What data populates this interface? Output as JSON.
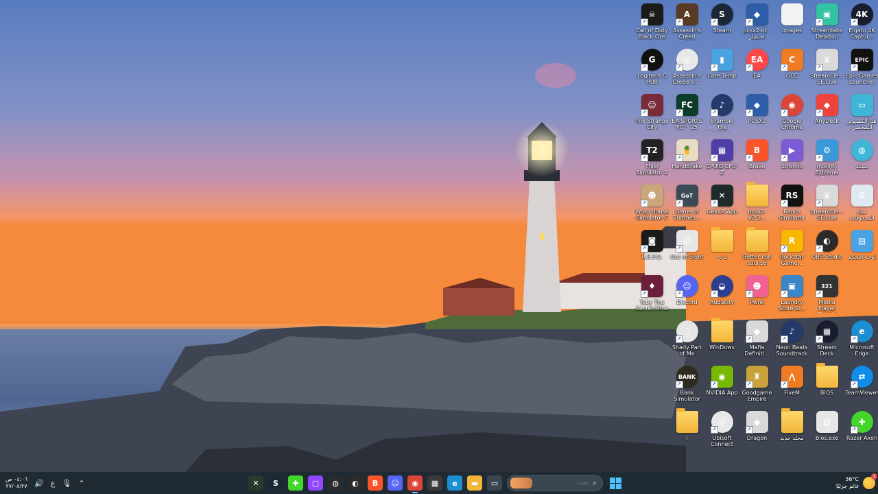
{
  "desktop": {
    "icons": [
      {
        "label": "Call of Duty Black Ops",
        "name": "call-of-duty-icon",
        "bg": "#1b1b1b",
        "glyph": "☠",
        "shortcut": true
      },
      {
        "label": "Assassin's Creed Mirage",
        "name": "assassins-creed-mirage-icon",
        "bg": "#5b3a24",
        "glyph": "A",
        "shortcut": true
      },
      {
        "label": "Steam",
        "name": "steam-icon",
        "bg": "#1b2838",
        "glyph": "S",
        "shortcut": true,
        "round": true
      },
      {
        "label": "pcsx2-qt - اختصار",
        "name": "pcsx2-qt-icon",
        "bg": "#2f5ea8",
        "glyph": "◆",
        "shortcut": true
      },
      {
        "label": "images",
        "name": "images-icon",
        "bg": "#f2f2f2",
        "glyph": "",
        "shortcut": false
      },
      {
        "label": "Streamlabs Desktop",
        "name": "streamlabs-icon",
        "bg": "#31c3a2",
        "glyph": "▣",
        "shortcut": true
      },
      {
        "label": "Elgato 4K Captur...",
        "name": "elgato-4k-icon",
        "bg": "#1a1d2e",
        "glyph": "4K",
        "shortcut": true,
        "round": true
      },
      {
        "label": "Logitech G HUB",
        "name": "logitech-g-hub-icon",
        "bg": "#111111",
        "glyph": "G",
        "shortcut": true,
        "round": true
      },
      {
        "label": "Assassin's Creed ®...",
        "name": "assassins-creed-2-icon",
        "bg": "#e8e8e8",
        "glyph": "◎",
        "shortcut": true,
        "round": true
      },
      {
        "label": "Core Temp",
        "name": "core-temp-icon",
        "bg": "#4aa3df",
        "glyph": "▮",
        "shortcut": true
      },
      {
        "label": "EA",
        "name": "ea-icon",
        "bg": "#ff4747",
        "glyph": "EA",
        "shortcut": true,
        "round": true
      },
      {
        "label": "GCC",
        "name": "gcc-icon",
        "bg": "#f07b23",
        "glyph": "C",
        "shortcut": true
      },
      {
        "label": "StreamEle... SE.Live",
        "name": "streamelements-se-live-icon",
        "bg": "#d9d9d9",
        "glyph": "♛",
        "shortcut": true
      },
      {
        "label": "Epic Games Launcher",
        "name": "epic-games-icon",
        "bg": "#111111",
        "glyph": "EPIC",
        "shortcut": true
      },
      {
        "label": "The Strange City",
        "name": "the-strange-city-icon",
        "bg": "#7a2b3a",
        "glyph": "☺",
        "shortcut": true
      },
      {
        "label": "EA SPORTS FC™ 25",
        "name": "ea-sports-fc-icon",
        "bg": "#0c3c2a",
        "glyph": "FC",
        "shortcut": true
      },
      {
        "label": "Bramble The Mountain ...",
        "name": "bramble-icon",
        "bg": "#233a6b",
        "glyph": "♪",
        "shortcut": true,
        "round": true
      },
      {
        "label": "PCSX2",
        "name": "pcsx2-icon",
        "bg": "#2f5ea8",
        "glyph": "◆",
        "shortcut": true
      },
      {
        "label": "Google Chrome",
        "name": "google-chrome-icon",
        "bg": "#db4437",
        "glyph": "◉",
        "shortcut": true,
        "round": true
      },
      {
        "label": "AnyDesk",
        "name": "anydesk-icon",
        "bg": "#ef443b",
        "glyph": "◆",
        "shortcut": true
      },
      {
        "label": "هذا الكمبيوتر الشخصي",
        "name": "this-pc-icon",
        "bg": "#3fb6d8",
        "glyph": "▭",
        "shortcut": false
      },
      {
        "label": "Thief Simulator 2",
        "name": "thief-simulator-2-icon",
        "bg": "#222222",
        "glyph": "T2",
        "shortcut": true
      },
      {
        "label": "HandBrake",
        "name": "handbrake-icon",
        "bg": "#e8dcc2",
        "glyph": "🍍",
        "shortcut": true
      },
      {
        "label": "CPUID CPU-Z",
        "name": "cpu-z-icon",
        "bg": "#4f3ea8",
        "glyph": "▦",
        "shortcut": true
      },
      {
        "label": "Brave",
        "name": "brave-icon",
        "bg": "#fb542b",
        "glyph": "B",
        "shortcut": true
      },
      {
        "label": "Stremio",
        "name": "stremio-icon",
        "bg": "#7b5bd6",
        "glyph": "▶",
        "shortcut": true
      },
      {
        "label": "Intel(R) Extreme Tu...",
        "name": "intel-xtu-icon",
        "bg": "#3a9ad9",
        "glyph": "⚙",
        "shortcut": true
      },
      {
        "label": "شبكة",
        "name": "network-icon",
        "bg": "#3fb6d8",
        "glyph": "◍",
        "shortcut": false,
        "round": true
      },
      {
        "label": "Wrap House Simulator C",
        "name": "wrap-house-simulator-icon",
        "bg": "#c9a77a",
        "glyph": "☻",
        "shortcut": true
      },
      {
        "label": "Game of Thrones...",
        "name": "game-of-thrones-icon",
        "bg": "#3c4a55",
        "glyph": "GoT",
        "shortcut": true
      },
      {
        "label": "GeXLR App",
        "name": "goxlr-app-icon",
        "bg": "#1e2b2a",
        "glyph": "✕",
        "shortcut": true
      },
      {
        "label": "pcsx2-v2.3...",
        "name": "pcsx2-folder-icon",
        "bg": "#f2b53a",
        "glyph": "",
        "shortcut": false,
        "folder": true
      },
      {
        "label": "Ranch Simulator",
        "name": "ranch-simulator-icon",
        "bg": "#111111",
        "glyph": "RS",
        "shortcut": true
      },
      {
        "label": "StreamEle... SE.Live",
        "name": "streamelements-se-live-2-icon",
        "bg": "#d9d9d9",
        "glyph": "♛",
        "shortcut": true
      },
      {
        "label": "سلة المحذوفات",
        "name": "recycle-bin-icon",
        "bg": "#dfe9f2",
        "glyph": "♻",
        "shortcut": false
      },
      {
        "label": "R.E.P.O.",
        "name": "repo-icon",
        "bg": "#1a1a1a",
        "glyph": "◙",
        "shortcut": true
      },
      {
        "label": "Out of Sight",
        "name": "out-of-sight-icon",
        "bg": "#e6e6e6",
        "glyph": "☺",
        "shortcut": true
      },
      {
        "label": "تزنن",
        "name": "folder-arabic-icon",
        "bg": "#f2b53a",
        "glyph": "",
        "shortcut": false,
        "folder": true
      },
      {
        "label": "Better call saul s6",
        "name": "better-call-saul-icon",
        "bg": "#f2b53a",
        "glyph": "",
        "shortcut": false,
        "folder": true
      },
      {
        "label": "Rockstar Game...",
        "name": "rockstar-games-icon",
        "bg": "#f8b800",
        "glyph": "R",
        "shortcut": true
      },
      {
        "label": "OBS Studio",
        "name": "obs-studio-icon",
        "bg": "#2b2b2b",
        "glyph": "◐",
        "shortcut": true,
        "round": true
      },
      {
        "label": "لوحة التحكم",
        "name": "control-panel-icon",
        "bg": "#4ba3e3",
        "glyph": "▤",
        "shortcut": false
      },
      {
        "label": "Toby The Secret Mine",
        "name": "toby-secret-mine-icon",
        "bg": "#6b1f3a",
        "glyph": "♦",
        "shortcut": true
      },
      {
        "label": "Discord",
        "name": "discord-icon",
        "bg": "#5865f2",
        "glyph": "☺",
        "shortcut": true,
        "round": true
      },
      {
        "label": "Audacity",
        "name": "audacity-icon",
        "bg": "#2c3e8f",
        "glyph": "◒",
        "shortcut": true,
        "round": true
      },
      {
        "label": "Pwnk",
        "name": "pwnk-icon",
        "bg": "#f06292",
        "glyph": "☻",
        "shortcut": true
      },
      {
        "label": "Laundry Store Si...",
        "name": "laundry-store-icon",
        "bg": "#3b86c6",
        "glyph": "▣",
        "shortcut": true
      },
      {
        "label": "Media Player Classic",
        "name": "media-player-classic-icon",
        "bg": "#333333",
        "glyph": "321",
        "shortcut": true
      },
      {
        "label": "",
        "name": "empty-slot",
        "bg": "transparent",
        "glyph": "",
        "shortcut": false,
        "empty": true
      },
      {
        "label": "",
        "name": "empty-slot",
        "bg": "transparent",
        "glyph": "",
        "shortcut": false,
        "empty": true
      },
      {
        "label": "Shady Part of Me",
        "name": "shady-part-of-me-icon",
        "bg": "#e6e6e6",
        "glyph": "☽",
        "shortcut": true,
        "round": true
      },
      {
        "label": "WinDows",
        "name": "windows-folder-icon",
        "bg": "#f2b53a",
        "glyph": "",
        "shortcut": false,
        "folder": true
      },
      {
        "label": "Mafia Definiti...",
        "name": "mafia-definitive-icon",
        "bg": "#d9d9d9",
        "glyph": "◆",
        "shortcut": true
      },
      {
        "label": "Neon Beats Soundtrack",
        "name": "neon-beats-icon",
        "bg": "#233a6b",
        "glyph": "♪",
        "shortcut": true,
        "round": true
      },
      {
        "label": "Stream Deck",
        "name": "stream-deck-icon",
        "bg": "#1a1d2e",
        "glyph": "▦",
        "shortcut": true,
        "round": true
      },
      {
        "label": "Microsoft Edge",
        "name": "microsoft-edge-icon",
        "bg": "#1b8fd2",
        "glyph": "e",
        "shortcut": true,
        "round": true
      },
      {
        "label": "",
        "name": "empty-slot",
        "bg": "transparent",
        "glyph": "",
        "shortcut": false,
        "empty": true
      },
      {
        "label": "Bank Simulator",
        "name": "bank-simulator-icon",
        "bg": "#2f2a1e",
        "glyph": "BANK",
        "shortcut": true,
        "round": true
      },
      {
        "label": "NVIDIA App",
        "name": "nvidia-app-icon",
        "bg": "#76b900",
        "glyph": "◉",
        "shortcut": true
      },
      {
        "label": "Goodgame Empire",
        "name": "goodgame-empire-icon",
        "bg": "#c9a03a",
        "glyph": "♜",
        "shortcut": true
      },
      {
        "label": "FiveM",
        "name": "fivem-icon",
        "bg": "#f07b23",
        "glyph": "⋀",
        "shortcut": true
      },
      {
        "label": "BIOS",
        "name": "bios-folder-icon",
        "bg": "#f2b53a",
        "glyph": "",
        "shortcut": false,
        "folder": true
      },
      {
        "label": "TeamViewer",
        "name": "teamviewer-icon",
        "bg": "#0e8ee9",
        "glyph": "⇄",
        "shortcut": true,
        "round": true
      },
      {
        "label": "",
        "name": "empty-slot",
        "bg": "transparent",
        "glyph": "",
        "shortcut": false,
        "empty": true
      },
      {
        "label": "i",
        "name": "folder-i-icon",
        "bg": "#f2b53a",
        "glyph": "",
        "shortcut": false,
        "folder": true
      },
      {
        "label": "Ubisoft Connect",
        "name": "ubisoft-connect-icon",
        "bg": "#e8e8e8",
        "glyph": "◎",
        "shortcut": true,
        "round": true
      },
      {
        "label": "Dragon",
        "name": "dragon-icon",
        "bg": "#d9d9d9",
        "glyph": "◆",
        "shortcut": true
      },
      {
        "label": "مجلد جديد",
        "name": "new-folder-icon",
        "bg": "#f2b53a",
        "glyph": "",
        "shortcut": false,
        "folder": true
      },
      {
        "label": "Bios.exe",
        "name": "bios-exe-icon",
        "bg": "#e6e6e6",
        "glyph": "▤",
        "shortcut": false
      },
      {
        "label": "Razer Axon",
        "name": "razer-axon-icon",
        "bg": "#44d62c",
        "glyph": "✚",
        "shortcut": true,
        "round": true
      }
    ]
  },
  "taskbar": {
    "clock": {
      "time": "٠٤:٠٦ ص",
      "date": "٢٧/٠٨/٢٧"
    },
    "tray": {
      "language": "ع",
      "volume_icon": "volume-icon",
      "mic_icon": "microphone-icon",
      "chevron_icon": "chevron-up-icon"
    },
    "apps": [
      {
        "name": "xbox-app-icon",
        "bg": "#2a3a2f",
        "glyph": "✕"
      },
      {
        "name": "steam-taskbar-icon",
        "bg": "#1b2838",
        "glyph": "S"
      },
      {
        "name": "razer-taskbar-icon",
        "bg": "#44d62c",
        "glyph": "✚"
      },
      {
        "name": "twitch-taskbar-icon",
        "bg": "#9146ff",
        "glyph": "▢"
      },
      {
        "name": "color-wheel-taskbar-icon",
        "bg": "#2b2b2b",
        "glyph": "◍"
      },
      {
        "name": "obs-taskbar-icon",
        "bg": "#2b2b2b",
        "glyph": "◐"
      },
      {
        "name": "brave-taskbar-icon",
        "bg": "#fb542b",
        "glyph": "B"
      },
      {
        "name": "discord-taskbar-icon",
        "bg": "#5865f2",
        "glyph": "☺"
      },
      {
        "name": "chrome-taskbar-icon",
        "bg": "#db4437",
        "glyph": "◉",
        "active": true
      },
      {
        "name": "store-taskbar-icon",
        "bg": "#3a3a3a",
        "glyph": "▦"
      },
      {
        "name": "edge-taskbar-icon",
        "bg": "#1b8fd2",
        "glyph": "e"
      },
      {
        "name": "file-explorer-taskbar-icon",
        "bg": "#f2b53a",
        "glyph": "▬"
      },
      {
        "name": "task-view-taskbar-icon",
        "bg": "#3a464f",
        "glyph": "▭"
      }
    ],
    "search": {
      "placeholder": "بحث"
    },
    "weather": {
      "temp": "36°C",
      "desc": "غائم جزئيًا",
      "badge": "1"
    }
  }
}
